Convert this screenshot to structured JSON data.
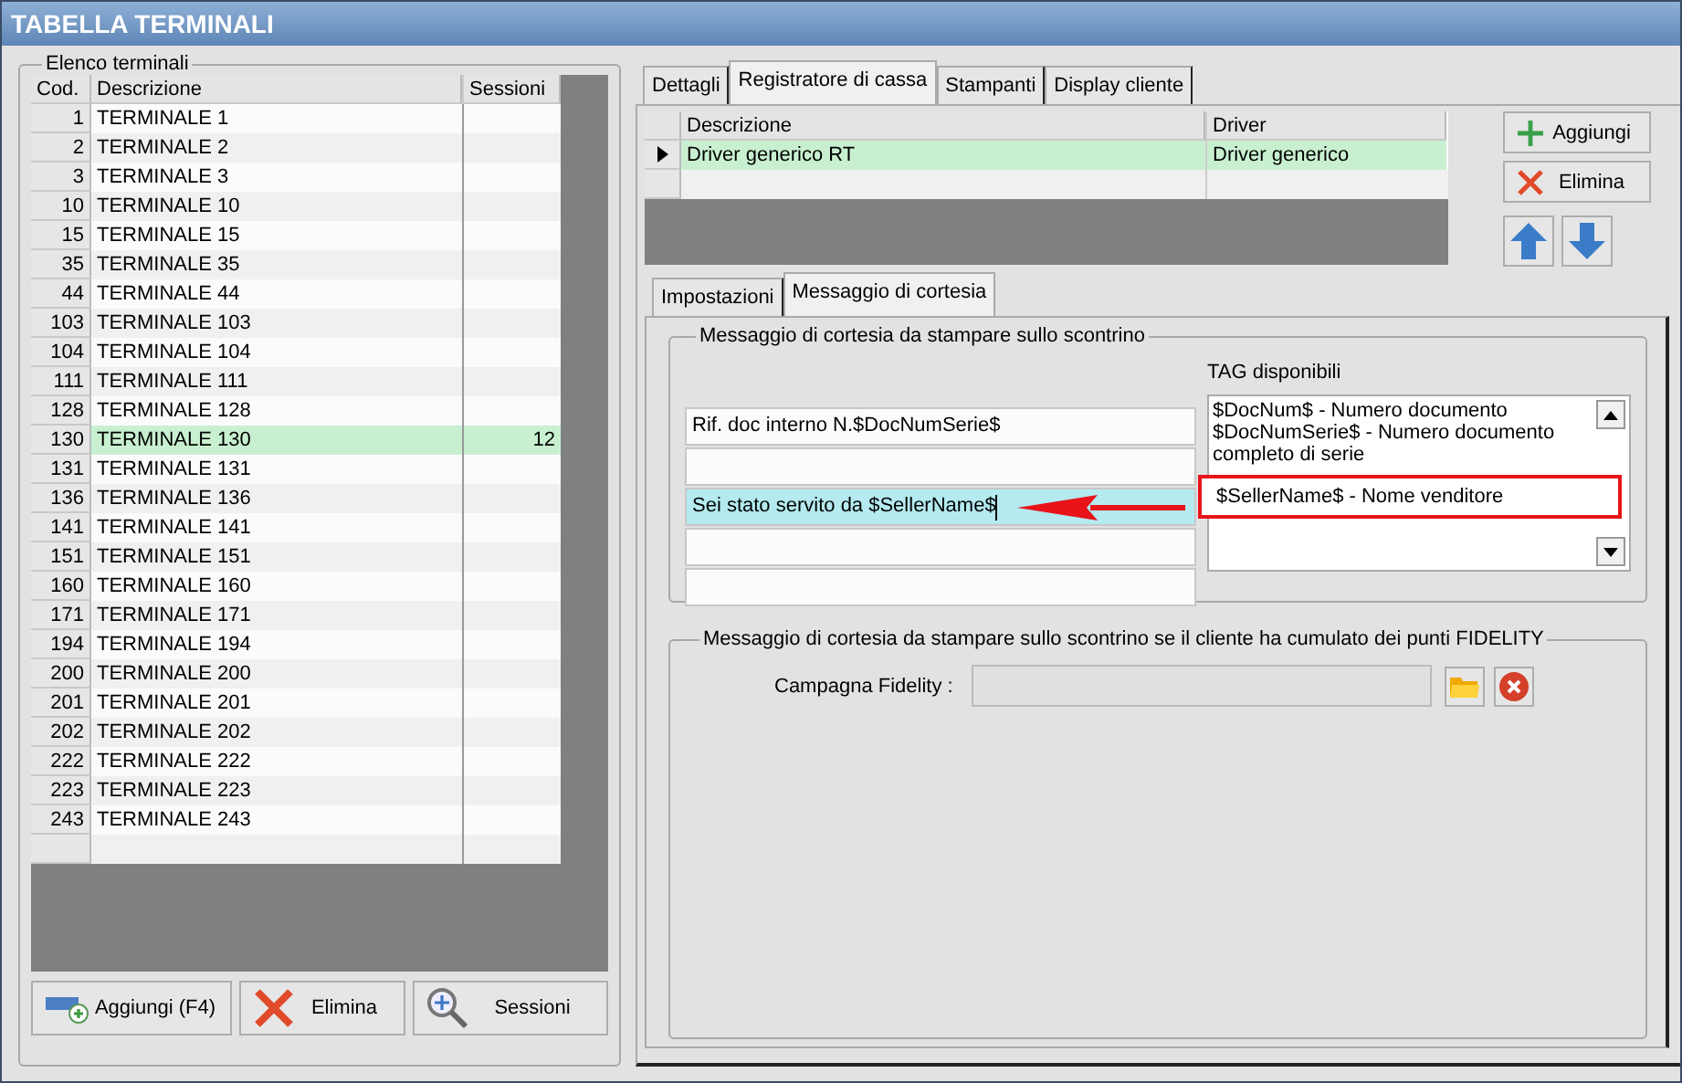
{
  "window": {
    "title": "TABELLA TERMINALI"
  },
  "terminals_group": {
    "title": "Elenco terminali",
    "columns": [
      "Cod.",
      "Descrizione",
      "Sessioni"
    ],
    "rows": [
      {
        "code": "1",
        "description": "TERMINALE 1",
        "sessions": "",
        "selected": false
      },
      {
        "code": "2",
        "description": "TERMINALE 2",
        "sessions": "",
        "selected": false
      },
      {
        "code": "3",
        "description": "TERMINALE 3",
        "sessions": "",
        "selected": false
      },
      {
        "code": "10",
        "description": "TERMINALE 10",
        "sessions": "",
        "selected": false
      },
      {
        "code": "15",
        "description": "TERMINALE 15",
        "sessions": "",
        "selected": false
      },
      {
        "code": "35",
        "description": "TERMINALE 35",
        "sessions": "",
        "selected": false
      },
      {
        "code": "44",
        "description": "TERMINALE 44",
        "sessions": "",
        "selected": false
      },
      {
        "code": "103",
        "description": "TERMINALE 103",
        "sessions": "",
        "selected": false
      },
      {
        "code": "104",
        "description": "TERMINALE 104",
        "sessions": "",
        "selected": false
      },
      {
        "code": "111",
        "description": "TERMINALE 111",
        "sessions": "",
        "selected": false
      },
      {
        "code": "128",
        "description": "TERMINALE 128",
        "sessions": "",
        "selected": false
      },
      {
        "code": "130",
        "description": "TERMINALE 130",
        "sessions": "12",
        "selected": true
      },
      {
        "code": "131",
        "description": "TERMINALE 131",
        "sessions": "",
        "selected": false
      },
      {
        "code": "136",
        "description": "TERMINALE 136",
        "sessions": "",
        "selected": false
      },
      {
        "code": "141",
        "description": "TERMINALE 141",
        "sessions": "",
        "selected": false
      },
      {
        "code": "151",
        "description": "TERMINALE 151",
        "sessions": "",
        "selected": false
      },
      {
        "code": "160",
        "description": "TERMINALE 160",
        "sessions": "",
        "selected": false
      },
      {
        "code": "171",
        "description": "TERMINALE 171",
        "sessions": "",
        "selected": false
      },
      {
        "code": "194",
        "description": "TERMINALE 194",
        "sessions": "",
        "selected": false
      },
      {
        "code": "200",
        "description": "TERMINALE 200",
        "sessions": "",
        "selected": false
      },
      {
        "code": "201",
        "description": "TERMINALE 201",
        "sessions": "",
        "selected": false
      },
      {
        "code": "202",
        "description": "TERMINALE 202",
        "sessions": "",
        "selected": false
      },
      {
        "code": "222",
        "description": "TERMINALE 222",
        "sessions": "",
        "selected": false
      },
      {
        "code": "223",
        "description": "TERMINALE 223",
        "sessions": "",
        "selected": false
      },
      {
        "code": "243",
        "description": "TERMINALE 243",
        "sessions": "",
        "selected": false
      }
    ],
    "buttons": [
      {
        "kind": "add",
        "label": "Aggiungi (F4)"
      },
      {
        "kind": "delete",
        "label": "Elimina"
      },
      {
        "kind": "sessions",
        "label": "Sessioni"
      }
    ]
  },
  "tabs": [
    {
      "label": "Dettagli",
      "selected": false
    },
    {
      "label": "Registratore di cassa",
      "selected": true
    },
    {
      "label": "Stampanti",
      "selected": false
    },
    {
      "label": "Display cliente",
      "selected": false
    }
  ],
  "drivers": {
    "columns": [
      "Descrizione",
      "Driver"
    ],
    "rows": [
      {
        "description": "Driver generico RT",
        "driver": "Driver generico",
        "selected": true
      }
    ],
    "buttons": [
      {
        "kind": "add",
        "label": "Aggiungi"
      },
      {
        "kind": "delete",
        "label": "Elimina"
      },
      {
        "kind": "up"
      },
      {
        "kind": "down"
      }
    ]
  },
  "subtabs": [
    {
      "label": "Impostazioni",
      "selected": false
    },
    {
      "label": "Messaggio di cortesia",
      "selected": true
    }
  ],
  "courtesy_group": {
    "title": "Messaggio di cortesia da stampare sullo scontrino",
    "lines": [
      {
        "value": "Rif. doc interno N.$DocNumSerie$",
        "focused": false
      },
      {
        "focused": false
      },
      {
        "value": "Sei stato servito da $SellerName$",
        "focused": true
      },
      {
        "focused": false
      },
      {
        "focused": false
      }
    ],
    "tags_label": "TAG disponibili",
    "tags": [
      {
        "text": "$DocNum$ - Numero documento",
        "highlighted": false
      },
      {
        "text": "$DocNumSerie$ - Numero documento completo di serie",
        "highlighted": false
      },
      {
        "text": "$SellerName$ - Nome venditore",
        "highlighted": true
      }
    ]
  },
  "fidelity_group": {
    "title": "Messaggio di cortesia da stampare sullo scontrino se il cliente ha cumulato dei punti FIDELITY",
    "label": "Campagna Fidelity :",
    "buttons": [
      {
        "kind": "browse"
      },
      {
        "kind": "clear"
      }
    ]
  }
}
